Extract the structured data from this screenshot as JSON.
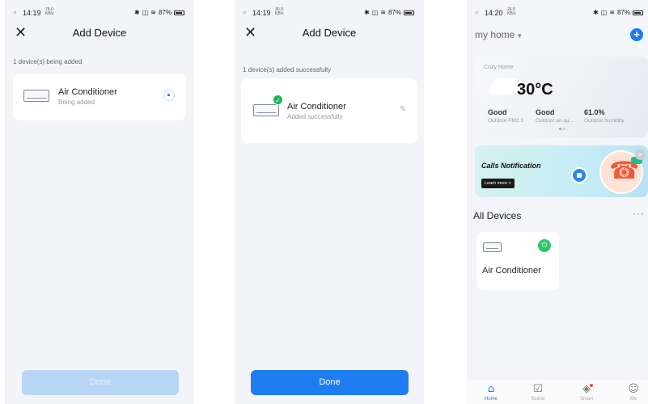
{
  "screens": [
    {
      "status": {
        "time": "14:19",
        "speed_top": "78.0",
        "speed_bottom": "KB/s",
        "battery": "87%"
      },
      "nav": {
        "title": "Add Device"
      },
      "hint": "1 device(s) being added",
      "device": {
        "name": "Air Conditioner",
        "status": "Being added"
      },
      "button": "Done"
    },
    {
      "status": {
        "time": "14:19",
        "speed_top": "30.9",
        "speed_bottom": "KB/s",
        "battery": "87%"
      },
      "nav": {
        "title": "Add Device"
      },
      "hint": "1 device(s) added successfully",
      "device": {
        "name": "Air Conditioner",
        "status": "Added successfully"
      },
      "button": "Done"
    },
    {
      "status": {
        "time": "14:20",
        "speed_top": "26.5",
        "speed_bottom": "KB/s",
        "battery": "87%"
      },
      "home_name": "my home",
      "weather": {
        "place": "Cozy Home",
        "temp": "30°C",
        "items": [
          {
            "value": "Good",
            "label": "Outdoor PM2.5"
          },
          {
            "value": "Good",
            "label": "Outdoor air qu…"
          },
          {
            "value": "61.0%",
            "label": "Outdoor humidity"
          }
        ]
      },
      "banner": {
        "title": "Calls Notification",
        "button": "Learn more >"
      },
      "all_devices_title": "All Devices",
      "device": {
        "name": "Air Conditioner"
      },
      "tabs": [
        {
          "label": "Home",
          "icon": "home-icon"
        },
        {
          "label": "Scene",
          "icon": "scene-icon"
        },
        {
          "label": "Smart",
          "icon": "smart-icon"
        },
        {
          "label": "Me",
          "icon": "profile-icon"
        }
      ]
    }
  ],
  "colors": {
    "accent": "#1e7df0",
    "success": "#1fb15a",
    "disabled": "#b9d5f6"
  }
}
